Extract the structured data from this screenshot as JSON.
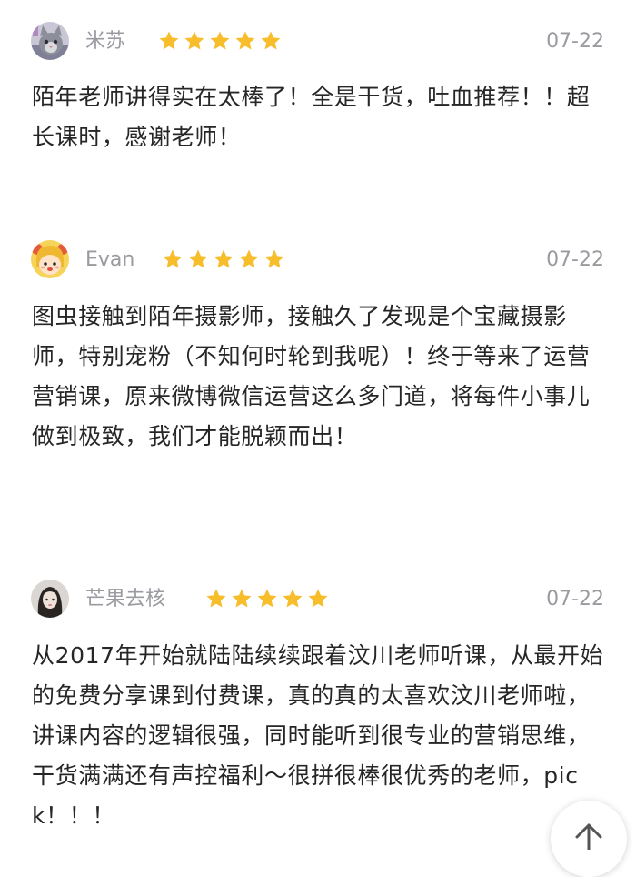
{
  "reviews": [
    {
      "name": "米苏",
      "date": "07-22",
      "rating": 5,
      "avatar": "cat-avatar",
      "text": "陌年老师讲得实在太棒了！全是干货，吐血推荐！！超长课时，感谢老师！"
    },
    {
      "name": "Evan",
      "date": "07-22",
      "rating": 5,
      "avatar": "cartoon-girl-avatar",
      "text": "图虫接触到陌年摄影师，接触久了发现是个宝藏摄影师，特别宠粉（不知何时轮到我呢）！终于等来了运营营销课，原来微博微信运营这么多门道，将每件小事儿做到极致，我们才能脱颖而出！"
    },
    {
      "name": "芒果去核",
      "date": "07-22",
      "rating": 5,
      "avatar": "portrait-avatar",
      "text": "从2017年开始就陆陆续续跟着汶川老师听课，从最开始的免费分享课到付费课，真的真的太喜欢汶川老师啦，讲课内容的逻辑很强，同时能听到很专业的营销思维，干货满满还有声控福利～很拼很棒很优秀的老师，pick！！！"
    }
  ],
  "colors": {
    "star": "#F7BD2B",
    "meta_text": "#9A9BA0",
    "body_text": "#262626"
  },
  "icons": {
    "scroll_top": "arrow-up-icon"
  }
}
